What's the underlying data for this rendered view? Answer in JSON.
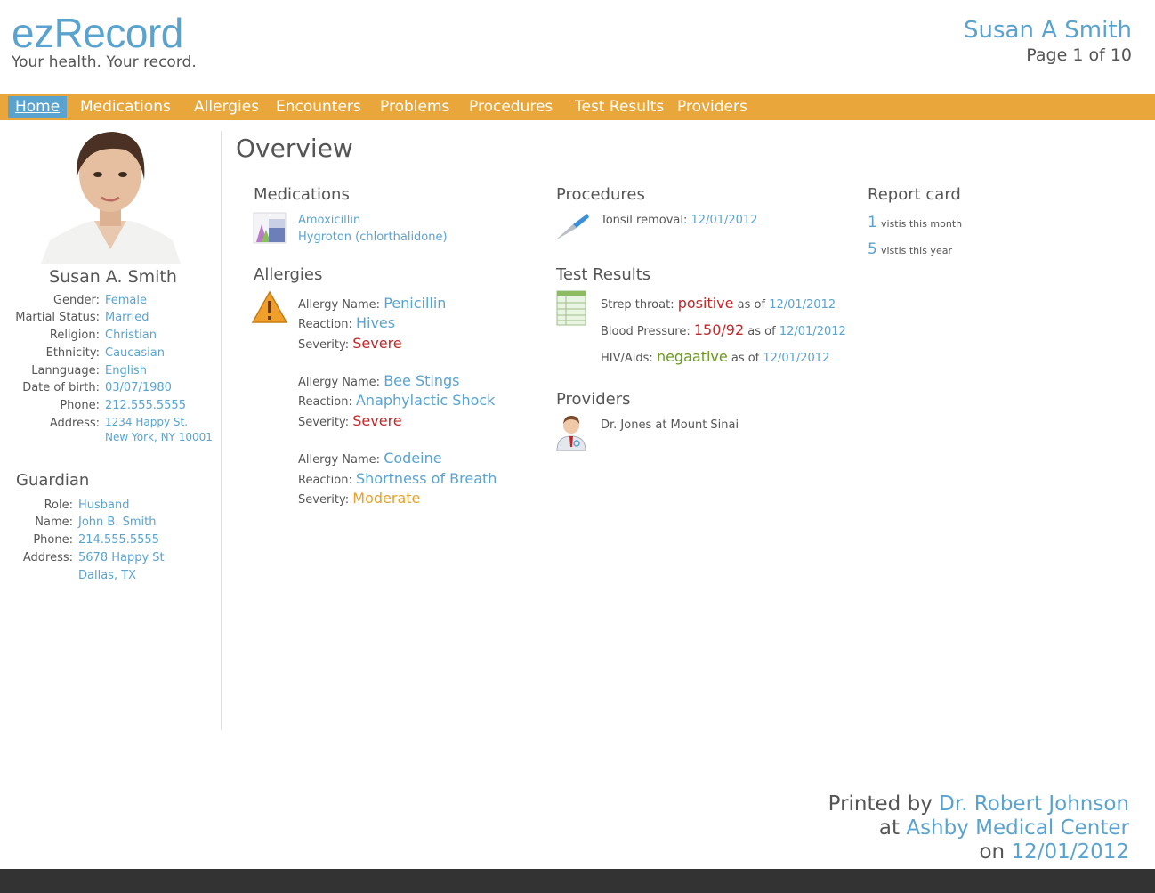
{
  "brand": {
    "name": "ezRecord",
    "tagline": "Your health. Your record."
  },
  "header": {
    "patient_name": "Susan A Smith",
    "page_info": "Page 1 of 10"
  },
  "nav": [
    {
      "label": "Home",
      "active": true
    },
    {
      "label": "Medications"
    },
    {
      "label": "Allergies"
    },
    {
      "label": "Encounters"
    },
    {
      "label": "Problems"
    },
    {
      "label": "Procedures"
    },
    {
      "label": "Test Results"
    },
    {
      "label": "Providers"
    }
  ],
  "patient": {
    "name": "Susan A. Smith",
    "fields": [
      {
        "label": "Gender:",
        "value": "Female"
      },
      {
        "label": "Martial Status:",
        "value": "Married"
      },
      {
        "label": "Religion:",
        "value": "Christian"
      },
      {
        "label": "Ethnicity:",
        "value": "Caucasian"
      },
      {
        "label": "Lannguage:",
        "value": "English"
      },
      {
        "label": "Date of birth:",
        "value": "03/07/1980"
      },
      {
        "label": "Phone:",
        "value": "212.555.5555"
      }
    ],
    "address_label": "Address:",
    "address_line1": "1234 Happy St.",
    "address_line2": "New York, NY 10001"
  },
  "guardian": {
    "title": "Guardian",
    "fields": [
      {
        "label": "Role:",
        "value": "Husband"
      },
      {
        "label": "Name:",
        "value": "John B. Smith"
      },
      {
        "label": "Phone:",
        "value": "214.555.5555"
      }
    ],
    "address_label": "Address:",
    "address_line1": "5678 Happy St",
    "address_line2": "Dallas, TX"
  },
  "overview": {
    "title": "Overview",
    "medications": {
      "title": "Medications",
      "items": [
        "Amoxicillin",
        "Hygroton (chlorthalidone)"
      ]
    },
    "allergies": {
      "title": "Allergies",
      "name_label": "Allergy Name:",
      "reaction_label": "Reaction:",
      "severity_label": "Severity:",
      "items": [
        {
          "name": "Penicillin",
          "reaction": "Hives",
          "severity": "Severe"
        },
        {
          "name": "Bee Stings",
          "reaction": "Anaphylactic Shock",
          "severity": "Severe"
        },
        {
          "name": "Codeine",
          "reaction": "Shortness of Breath",
          "severity": "Moderate"
        }
      ]
    },
    "procedures": {
      "title": "Procedures",
      "items": [
        {
          "label": "Tonsil removal:",
          "date": "12/01/2012"
        }
      ]
    },
    "test_results": {
      "title": "Test Results",
      "as_of": "as of",
      "items": [
        {
          "label": "Strep throat:",
          "result": "positive",
          "date": "12/01/2012"
        },
        {
          "label": "Blood Pressure:",
          "result": "150/92",
          "date": "12/01/2012"
        },
        {
          "label": "HIV/Aids:",
          "result": "negaative",
          "date": "12/01/2012"
        }
      ]
    },
    "providers": {
      "title": "Providers",
      "items": [
        "Dr. Jones at Mount Sinai"
      ]
    },
    "report_card": {
      "title": "Report card",
      "items": [
        {
          "count": "1",
          "label": "vistis this month"
        },
        {
          "count": "5",
          "label": "vistis this year"
        }
      ]
    }
  },
  "footer": {
    "printed_by_label": "Printed by",
    "printed_by": "Dr. Robert Johnson",
    "at_label": "at",
    "at": "Ashby Medical Center",
    "on_label": "on",
    "on": "12/01/2012"
  },
  "colors": {
    "accent_blue": "#5aa3cf",
    "nav_orange": "#e9a73b",
    "severe_red": "#c0282a",
    "moderate_orange": "#e4a12e",
    "negative_green": "#6a9a1a",
    "footer_bar": "#333333"
  }
}
